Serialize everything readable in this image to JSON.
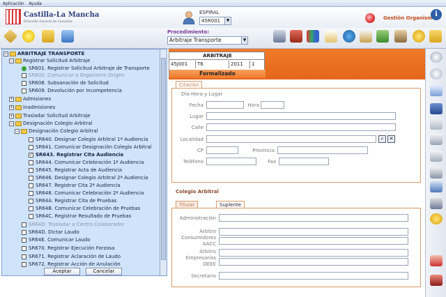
{
  "menubar": {
    "items": [
      "Aplicación",
      "Ayuda"
    ]
  },
  "header": {
    "brand": "Castilla-La Mancha",
    "brand_sub": "Dirección General de Consumo",
    "espiral_label": "ESPIRAL",
    "espiral_value": "45R001",
    "org_label": "Gestión Organismo",
    "info_glyph": "i"
  },
  "toolbar": {
    "procedimiento_label": "Procedimiento:",
    "procedimiento_value": "Arbitraje Transporte"
  },
  "tree": {
    "root": "ARBITRAJE TRANSPORTE",
    "items": [
      {
        "label": "Registrar Solicitud Arbitraje"
      },
      {
        "label": "SR601. Registrar Solicitud Arbitraje de Transporte"
      },
      {
        "label": "SR602. Comunicar a Organismo Origen"
      },
      {
        "label": "SR608. Subsanación de Solicitud"
      },
      {
        "label": "SR609. Devolución por Incompetencia"
      },
      {
        "label": "Admisiones"
      },
      {
        "label": "Inadmisiones"
      },
      {
        "label": "Trasladar Solicitud Arbitraje"
      },
      {
        "label": "Designación Colegio Arbitral"
      },
      {
        "label": "Designación Colegio Arbitral"
      },
      {
        "label": "SR640. Designar Colegio Arbitral 1ª Audiencia"
      },
      {
        "label": "SR641. Comunicar Designación Colegio Arbitral"
      },
      {
        "label": "SR643. Registrar Cita Audiencia"
      },
      {
        "label": "SR644. Comunicar Celebración 1ª Audiencia"
      },
      {
        "label": "SR645. Registrar Acta de Audiencia"
      },
      {
        "label": "SR646. Designar Colegio Arbitral 2ª Audiencia"
      },
      {
        "label": "SR647. Registrar Cita 2ª Audiencia"
      },
      {
        "label": "SR648. Comunicar Celebración 2ª Audiencia"
      },
      {
        "label": "SR64A. Registrar Cita de Pruebas"
      },
      {
        "label": "SR64B. Comunicar Celebración de Pruebas"
      },
      {
        "label": "SR64C. Registrar Resultado de Pruebas"
      },
      {
        "label": "SR64D. Trasladar a Centro Colaborador"
      },
      {
        "label": "SR64D. Dictar Laudo"
      },
      {
        "label": "SR64E. Comunicar Laudo"
      },
      {
        "label": "SR670. Registrar Ejecución Forzosa"
      },
      {
        "label": "SR671. Registrar Aclaración de Laudo"
      },
      {
        "label": "SR672. Registrar Acción de Anulación"
      }
    ],
    "accept_label": "Aceptar",
    "cancel_label": "Cancelar"
  },
  "record": {
    "title": "ARBITRAJE",
    "org": "45J001",
    "type": "T6",
    "year": "2011",
    "num": "1",
    "status": "Formalizado"
  },
  "form": {
    "tab_citacion": "Citación",
    "section_dia_hora": "Día-Hora y Lugar",
    "fecha": "Fecha",
    "hora": "Hora",
    "lugar": "Lugar",
    "calle": "Calle",
    "localidad": "Localidad",
    "cp": "CP",
    "provincia": "Provincia",
    "telefono": "Teléfono",
    "fax": "Fax",
    "colegio_title": "Colegio Arbitral",
    "tab_titular": "Titular",
    "tab_suplente": "Suplente",
    "administracion": "Administración",
    "arbitro_consumidores": "Árbitro Consumidores AACC",
    "arbitro_empresarios": "Árbitro Empresarios OEEE",
    "secretario": "Secretario"
  },
  "colors": {
    "orange": "#ec6f20",
    "tree_bg": "#cfe3fb",
    "selection": "#2f5fae"
  }
}
